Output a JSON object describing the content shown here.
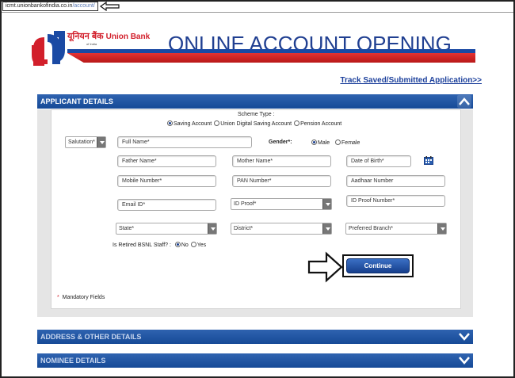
{
  "browser": {
    "url_domain": "icmt.unionbankofindia.co.in",
    "url_path": "/account/"
  },
  "brand": {
    "hindi_name": "यूनियन बैंक",
    "english_name": "Union Bank",
    "sub_line": "of India",
    "page_title": "ONLINE ACCOUNT OPENING"
  },
  "links": {
    "track": "Track Saved/Submitted Application>>"
  },
  "sections": {
    "applicant": "APPLICANT DETAILS",
    "address": "ADDRESS & OTHER DETAILS",
    "nominee": "NOMINEE DETAILS"
  },
  "scheme": {
    "label": "Scheme Type :",
    "options": [
      "Saving Account",
      "Union Digital Saving Account",
      "Pension Account"
    ],
    "selected": "Saving Account"
  },
  "form": {
    "salutation": "Salutation*",
    "full_name": "Full Name*",
    "gender_label": "Gender*:",
    "gender_options": [
      "Male",
      "Female"
    ],
    "father_name": "Father Name*",
    "mother_name": "Mother Name*",
    "dob": "Date of Birth*",
    "mobile": "Mobile Number*",
    "pan": "PAN Number*",
    "aadhaar": "Aadhaar Number",
    "email": "Email ID*",
    "id_proof": "ID Proof*",
    "id_proof_number": "ID Proof Number*",
    "state": "State*",
    "district": "District*",
    "branch": "Preferred Branch*",
    "bsnl_label": "Is Retired BSNL Staff? :",
    "bsnl_options": [
      "No",
      "Yes"
    ]
  },
  "buttons": {
    "continue": "Continue"
  },
  "footer": {
    "mandatory_star": "*",
    "mandatory_text": "Mandatory Fields"
  },
  "colors": {
    "brand_blue": "#1b4aa4",
    "brand_red": "#d21f2b",
    "section_bar": "#1f56a3"
  }
}
